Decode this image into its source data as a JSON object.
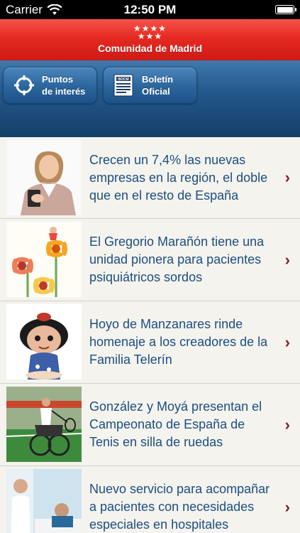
{
  "status_bar": {
    "carrier": "Carrier",
    "time": "12:50 PM",
    "icons": [
      "wifi-icon",
      "battery-icon"
    ]
  },
  "brand": {
    "title": "Comunidad de Madrid",
    "stars_top": "★★★★",
    "stars_bottom": "★★★",
    "color": "#e52a22"
  },
  "toolbar": {
    "buttons": [
      {
        "label_line1": "Puntos",
        "label_line2": "de interés",
        "icon": "crosshair-icon"
      },
      {
        "label_line1": "Boletín",
        "label_line2": "Oficial",
        "icon": "bocm-icon",
        "icon_text": "BOCM"
      }
    ],
    "color": "#24598d"
  },
  "news": {
    "items": [
      {
        "headline": "Crecen un 7,4% las nuevas empresas en la región, el doble que en el resto de España",
        "thumb": "businesswoman-photo"
      },
      {
        "headline": "El Gregorio Marañón tiene una unidad pionera para pacientes psiquiátricos sordos",
        "thumb": "flowers-illustration"
      },
      {
        "headline": "Hoyo de Manzanares rinde homenaje a los creadores de la Familia Telerín",
        "thumb": "telerin-doll-photo"
      },
      {
        "headline": "González y Moyá presentan el Campeonato de España de Tenis en silla de ruedas",
        "thumb": "wheelchair-tennis-photo"
      },
      {
        "headline": "Nuevo servicio para acompañar a pacientes con necesidades especiales en hospitales",
        "thumb": "hospital-patient-photo"
      }
    ],
    "chevron": "›",
    "headline_color": "#1c4e80",
    "chevron_color": "#8a1d1d"
  }
}
